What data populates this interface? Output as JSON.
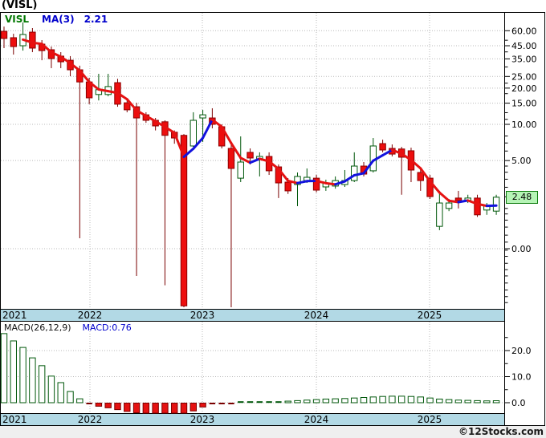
{
  "title": "(VISL)",
  "watermark": "©12Stocks.com",
  "price_pane": {
    "legend": {
      "symbol": "VISL",
      "ma_label": "MA(3)",
      "ma_value": "2.21"
    },
    "last_price_badge": "2.48"
  },
  "macd_pane": {
    "legend": {
      "label": "MACD(26,12,9)",
      "value_label": "MACD:0.76"
    }
  },
  "colors": {
    "band_blue": "#b2d9e5",
    "frame": "#000000",
    "grid": "#b9b9b9",
    "down_fill": "#ed0e0e",
    "down_border": "#8c0000",
    "down_wick": "#7a0000",
    "up_fill": "#ffffff",
    "up_border": "#00570a",
    "ma_up": "#1212dd",
    "ma_down": "#e51212",
    "legend_green": "#007700",
    "legend_blue": "#0000cc",
    "badge_bg": "#b6f4b6",
    "macd_pos_fill": "#ffffff",
    "macd_pos_border": "#00570a",
    "macd_neg_fill": "#e51212",
    "macd_neg_border": "#7a0000"
  },
  "chart_data": [
    {
      "type": "candlestick",
      "title": "VISL monthly candlesticks with MA(3)",
      "scale": "log",
      "ylim": [
        0.28,
        72
      ],
      "grid": true,
      "x_year_labels": [
        "2021",
        "2022",
        "2023",
        "2024",
        "2025"
      ],
      "y_axis": {
        "labels": [
          "60.00",
          "45.00",
          "35.00",
          "25.00",
          "20.00",
          "15.00",
          "10.00",
          "5.00",
          "0.00"
        ],
        "values": [
          60,
          45,
          35,
          25,
          20,
          15,
          10,
          5,
          0
        ]
      },
      "minor_ticks": [
        50,
        40,
        30,
        22,
        18,
        12.5,
        11,
        8,
        7,
        6,
        4.5,
        4,
        3.5,
        3,
        2.5,
        2,
        1.8,
        1.6,
        1.4,
        1.2,
        1.05,
        0.9,
        0.8,
        0.7,
        0.62,
        0.55,
        0.48,
        0.42,
        0.37,
        0.33
      ],
      "ma_period": 3,
      "ma_last_value": 2.21,
      "last_close": 2.48,
      "candles_ohlc": [
        [
          59.3,
          65.0,
          43.0,
          51.7
        ],
        [
          52.5,
          56.6,
          38.0,
          44.3
        ],
        [
          45.0,
          70.3,
          41.0,
          55.8
        ],
        [
          58.4,
          63.1,
          39.8,
          43.0
        ],
        [
          46.4,
          50.1,
          34.1,
          41.0
        ],
        [
          41.7,
          44.3,
          29.3,
          35.2
        ],
        [
          36.9,
          39.8,
          29.3,
          33.1
        ],
        [
          34.1,
          36.9,
          25.1,
          28.4
        ],
        [
          28.4,
          30.7,
          1.13,
          22.5
        ],
        [
          22.5,
          24.4,
          14.7,
          16.6
        ],
        [
          17.7,
          26.3,
          15.8,
          19.4
        ],
        [
          17.7,
          26.3,
          17.1,
          20.6
        ],
        [
          22.2,
          23.9,
          14.0,
          14.7
        ],
        [
          15.1,
          16.3,
          12.6,
          13.2
        ],
        [
          14.0,
          15.1,
          0.55,
          11.3
        ],
        [
          12.0,
          12.6,
          10.3,
          10.8
        ],
        [
          10.8,
          11.3,
          8.9,
          9.7
        ],
        [
          10.5,
          10.8,
          0.46,
          8.1
        ],
        [
          8.6,
          8.9,
          6.9,
          7.7
        ],
        [
          8.1,
          8.3,
          0.3,
          0.31
        ],
        [
          6.61,
          12.6,
          6.5,
          10.8
        ],
        [
          11.3,
          13.2,
          7.13,
          12.0
        ],
        [
          11.3,
          13.6,
          9.26,
          10.0
        ],
        [
          9.55,
          10.0,
          6.31,
          6.61
        ],
        [
          6.31,
          6.81,
          0.29,
          4.3
        ],
        [
          3.57,
          7.94,
          3.31,
          4.86
        ],
        [
          5.85,
          6.31,
          4.64,
          5.25
        ],
        [
          5.17,
          5.85,
          3.69,
          5.41
        ],
        [
          5.41,
          5.85,
          3.8,
          4.11
        ],
        [
          4.43,
          4.64,
          2.44,
          3.26
        ],
        [
          3.31,
          3.57,
          2.64,
          2.8
        ],
        [
          3.16,
          3.98,
          2.09,
          3.69
        ],
        [
          3.41,
          4.3,
          3.26,
          3.63
        ],
        [
          3.57,
          3.8,
          2.72,
          2.84
        ],
        [
          3.02,
          3.47,
          2.8,
          3.26
        ],
        [
          3.07,
          3.69,
          2.92,
          3.41
        ],
        [
          3.16,
          4.17,
          3.02,
          3.41
        ],
        [
          3.41,
          5.85,
          3.31,
          4.5
        ],
        [
          4.5,
          4.86,
          3.69,
          3.86
        ],
        [
          4.11,
          7.7,
          3.98,
          6.61
        ],
        [
          6.92,
          7.46,
          5.85,
          6.12
        ],
        [
          6.31,
          6.81,
          5.41,
          5.66
        ],
        [
          6.24,
          6.5,
          2.6,
          5.33
        ],
        [
          6.03,
          6.4,
          3.31,
          4.17
        ],
        [
          3.98,
          4.3,
          2.8,
          3.41
        ],
        [
          3.57,
          3.8,
          2.4,
          2.51
        ],
        [
          1.42,
          2.8,
          1.32,
          2.22
        ],
        [
          2.0,
          2.4,
          1.9,
          2.22
        ],
        [
          2.44,
          2.8,
          2.0,
          2.33
        ],
        [
          2.33,
          2.6,
          2.22,
          2.44
        ],
        [
          2.44,
          2.6,
          1.7,
          1.77
        ],
        [
          1.94,
          2.22,
          1.77,
          2.09
        ],
        [
          1.9,
          2.6,
          1.77,
          2.48
        ]
      ]
    },
    {
      "type": "bar",
      "title": "MACD(26,12,9) histogram",
      "last_value": 0.76,
      "grid": true,
      "x_year_labels": [
        "2021",
        "2022",
        "2023",
        "2024",
        "2025"
      ],
      "y_axis": {
        "labels": [
          "20.0",
          "10.0",
          "0.0"
        ],
        "values": [
          20,
          10,
          0
        ]
      },
      "minor_ticks": [
        25,
        15,
        5
      ],
      "values": [
        26.5,
        23.7,
        21.2,
        17.2,
        14.2,
        10.2,
        7.7,
        4.3,
        1.5,
        -0.3,
        -1.2,
        -1.8,
        -2.5,
        -3.2,
        -3.7,
        -4.0,
        -4.0,
        -4.0,
        -4.0,
        -4.0,
        -3.0,
        -1.5,
        -0.5,
        -0.3,
        -0.3,
        0.2,
        0.25,
        0.3,
        0.4,
        0.5,
        0.6,
        0.8,
        1.0,
        1.2,
        1.4,
        1.5,
        1.6,
        1.8,
        2.0,
        2.2,
        2.4,
        2.5,
        2.5,
        2.4,
        2.2,
        1.8,
        1.4,
        1.2,
        1.0,
        0.9,
        0.8,
        0.7,
        0.76
      ]
    }
  ]
}
